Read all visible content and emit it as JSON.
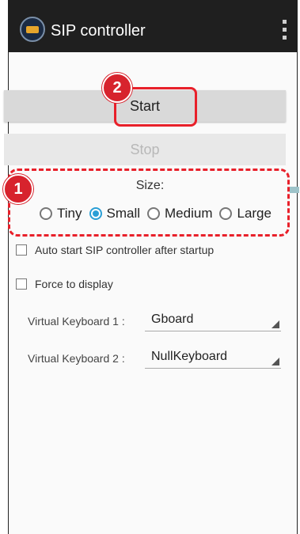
{
  "app": {
    "title": "SIP controller"
  },
  "buttons": {
    "start": "Start",
    "stop": "Stop"
  },
  "callouts": {
    "one": "1",
    "two": "2"
  },
  "size": {
    "label": "Size:",
    "options": [
      "Tiny",
      "Small",
      "Medium",
      "Large"
    ],
    "selected": "Small"
  },
  "options": {
    "auto_start": "Auto start SIP controller after startup",
    "force_display": "Force to display"
  },
  "keyboards": {
    "vk1_label": "Virtual Keyboard 1 :",
    "vk1_value": "Gboard",
    "vk2_label": "Virtual Keyboard 2 :",
    "vk2_value": "NullKeyboard"
  },
  "colors": {
    "accent": "#2a9fd6",
    "callout": "#e8202a",
    "appbar": "#1f1f1f"
  }
}
